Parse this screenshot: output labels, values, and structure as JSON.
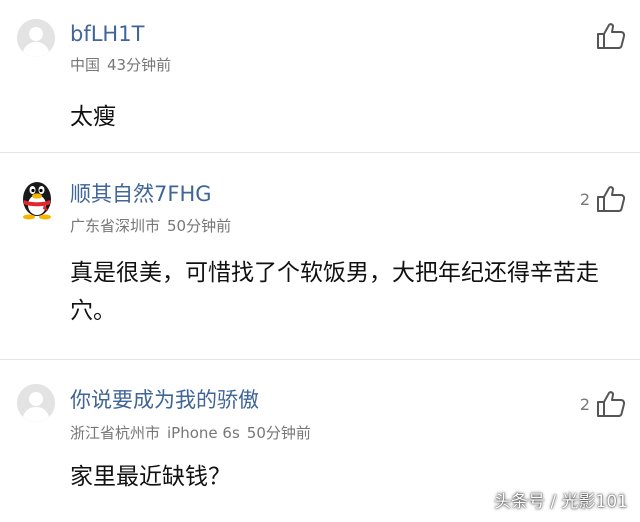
{
  "comments": [
    {
      "username": "bfLH1T",
      "location": "中国",
      "time": "43分钟前",
      "text": "太瘦",
      "likes": "",
      "avatar": "default-avatar"
    },
    {
      "username": "顺其自然7FHG",
      "location": "广东省深圳市",
      "time": "50分钟前",
      "text": "真是很美，可惜找了个软饭男，大把年纪还得辛苦走穴。",
      "likes": "2",
      "avatar": "qq-penguin-avatar"
    },
    {
      "username": "你说要成为我的骄傲",
      "location": "浙江省杭州市",
      "device": "iPhone 6s",
      "time": "50分钟前",
      "text": "家里最近缺钱？",
      "likes": "2",
      "avatar": "default-avatar"
    }
  ],
  "watermark": "头条号 / 光影101",
  "icons": {
    "like": "thumbs-up-icon"
  },
  "colors": {
    "username": "#406599",
    "meta": "#777777",
    "text": "#111111",
    "divider": "#e4e4e4"
  }
}
